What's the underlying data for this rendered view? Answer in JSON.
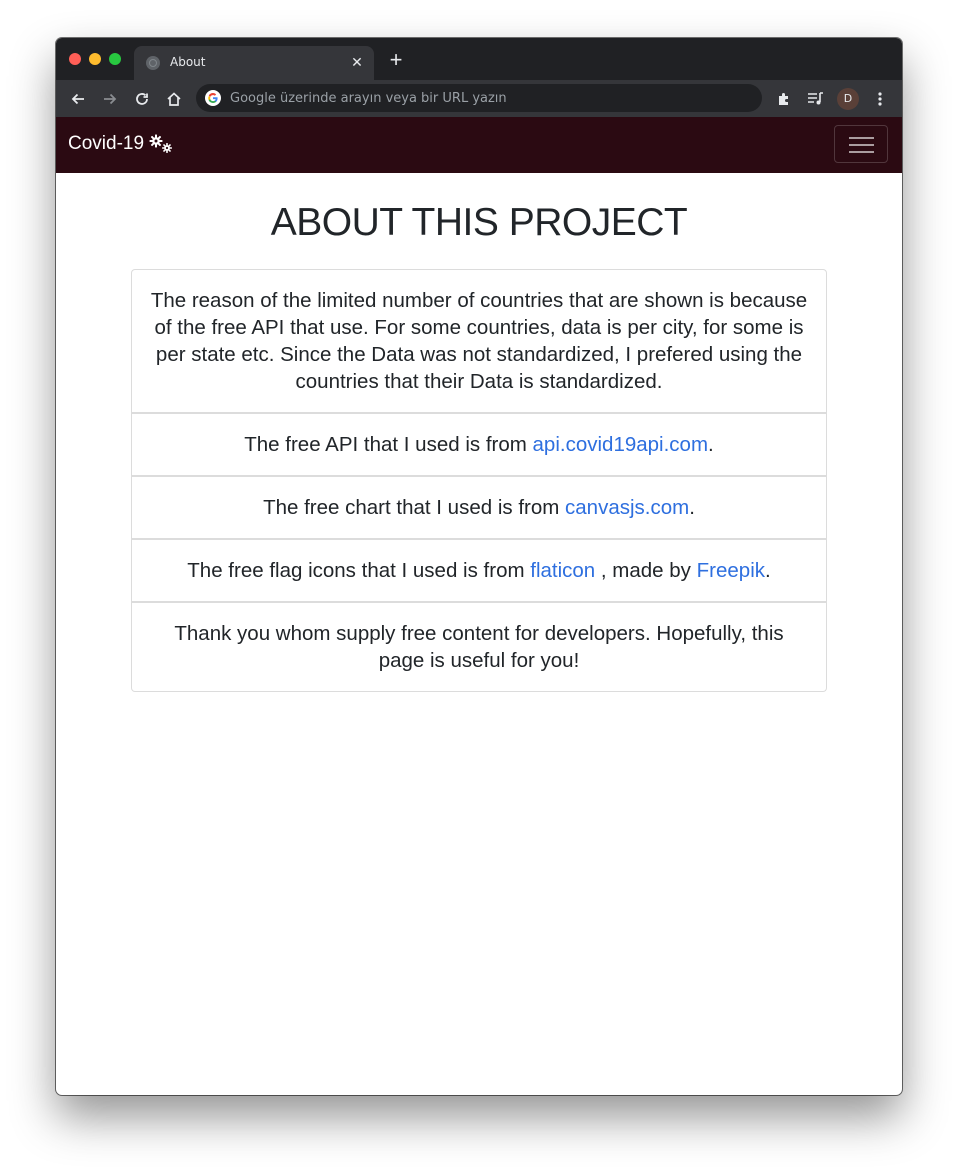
{
  "browser": {
    "tab_title": "About",
    "new_tab_symbol": "+",
    "close_symbol": "✕",
    "omnibox_placeholder": "Google üzerinde arayın veya bir URL yazın",
    "avatar_initial": "D"
  },
  "navbar": {
    "brand": "Covid-19",
    "brand_icon": "gears-icon",
    "background": "#2b0a12"
  },
  "page": {
    "title": "ABOUT THIS PROJECT",
    "items": [
      {
        "text": "The reason of the limited number of countries that are shown is because of the free API that use. For some countries, data is per city, for some is per state etc. Since the Data was not standardized, I prefered using the countries that their Data is standardized."
      },
      {
        "prefix": "The free API that I used is from ",
        "link": "api.covid19api.com",
        "suffix": "."
      },
      {
        "prefix": "The free chart that I used is from ",
        "link": "canvasjs.com",
        "suffix": "."
      },
      {
        "prefix": "The free flag icons that I used is from ",
        "link1": "flaticon",
        "middle": " , made by ",
        "link2": "Freepik",
        "suffix": "."
      },
      {
        "text": "Thank you whom supply free content for developers. Hopefully, this page is useful for you!"
      }
    ]
  },
  "colors": {
    "link": "#2e6fdf",
    "text": "#212529"
  }
}
